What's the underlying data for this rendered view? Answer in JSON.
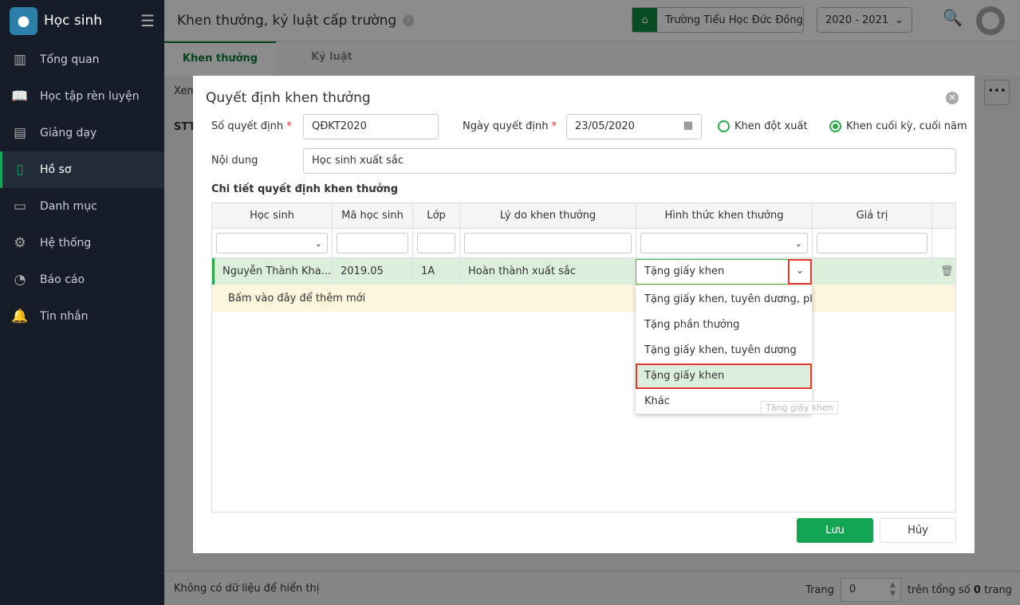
{
  "sidebar": {
    "app_name": "Học sinh",
    "items": [
      {
        "label": "Tổng quan",
        "icon": "bar-chart-icon"
      },
      {
        "label": "Học tập rèn luyện",
        "icon": "book-icon"
      },
      {
        "label": "Giảng dạy",
        "icon": "board-icon"
      },
      {
        "label": "Hồ sơ",
        "icon": "document-icon",
        "active": true
      },
      {
        "label": "Danh mục",
        "icon": "folder-icon"
      },
      {
        "label": "Hệ thống",
        "icon": "gear-icon"
      },
      {
        "label": "Báo cáo",
        "icon": "pie-chart-icon"
      },
      {
        "label": "Tin nhắn",
        "icon": "bell-icon"
      }
    ]
  },
  "header": {
    "title": "Khen thưởng, kỷ luật cấp trường",
    "help": "?",
    "school": "Trường Tiểu Học Đức Đồng",
    "year": "2020 - 2021"
  },
  "tabs": [
    "Khen thưởng",
    "Kỷ luật"
  ],
  "page": {
    "xem": "Xem",
    "stt": "STT",
    "more": "•••"
  },
  "footer": {
    "empty": "Không có dữ liệu để hiển thị",
    "trang": "Trang",
    "page_value": "0",
    "tren_tong_so": "trên tổng số",
    "total": "0",
    "trang_suffix": "trang"
  },
  "modal": {
    "title": "Quyết định khen thưởng",
    "so_qd_label": "Số quyết định",
    "so_qd_value": "QĐKT2020",
    "ngay_label": "Ngày quyết định",
    "ngay_value": "23/05/2020",
    "radio1": "Khen đột xuất",
    "radio2": "Khen cuối kỳ, cuối năm",
    "selected_radio": "Khen cuối kỳ, cuối năm",
    "noi_dung_label": "Nội dung",
    "noi_dung_value": "Học sinh xuất sắc",
    "section": "Chi tiết quyết định khen thưởng",
    "columns": [
      "Học sinh",
      "Mã học sinh",
      "Lớp",
      "Lý do khen thưởng",
      "Hình thức khen thưởng",
      "Giá trị"
    ],
    "row": {
      "hoc_sinh": "Nguyễn Thành Kha...",
      "ma": "2019.05",
      "lop": "1A",
      "ly_do": "Hoàn thành xuất sắc",
      "hinh_thuc": "Tặng giấy khen",
      "gia_tri": ""
    },
    "add_new": "Bấm vào đây để thêm mới",
    "dropdown_options": [
      "Tặng giấy khen, tuyên dương, phần thưởng",
      "Tặng phần thưởng",
      "Tặng giấy khen, tuyên dương",
      "Tặng giấy khen",
      "Khác"
    ],
    "highlighted_option": "Tặng giấy khen",
    "tooltip": "Tặng giấy khen",
    "save": "Lưu",
    "cancel": "Hủy"
  }
}
